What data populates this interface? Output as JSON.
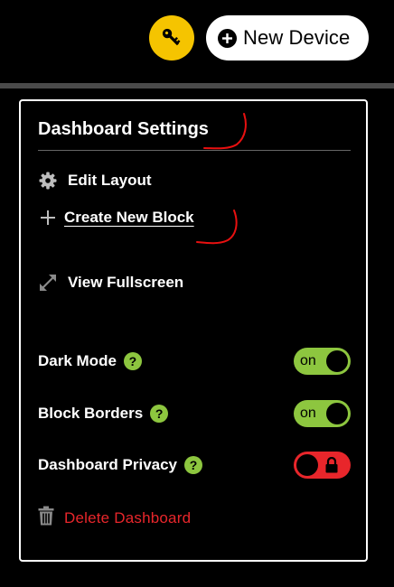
{
  "header": {
    "key_icon": "key-icon",
    "new_device_label": "New Device"
  },
  "panel": {
    "title": "Dashboard Settings",
    "menu": {
      "edit_layout": "Edit Layout",
      "create_block": "Create New Block",
      "view_fullscreen": "View Fullscreen"
    },
    "toggles": [
      {
        "label": "Dark Mode",
        "state": "on",
        "help": "?"
      },
      {
        "label": "Block Borders",
        "state": "on",
        "help": "?"
      },
      {
        "label": "Dashboard Privacy",
        "state": "off",
        "help": "?"
      }
    ],
    "delete_label": "Delete Dashboard"
  },
  "colors": {
    "key_button": "#f5c400",
    "toggle_on": "#8dc63f",
    "toggle_off": "#e8262b",
    "delete": "#e8262b"
  }
}
